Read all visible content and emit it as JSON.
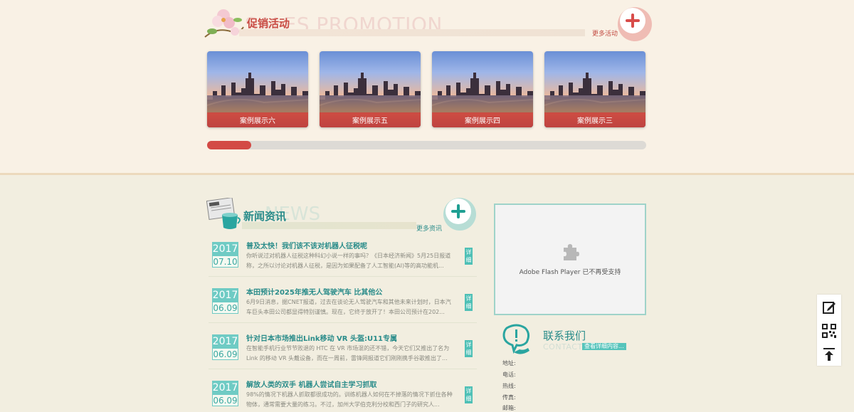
{
  "promotion": {
    "title": "促销活动",
    "bg_title": "SALES PROMOTION",
    "more_label": "更多活动",
    "cards": [
      {
        "caption": "案例展示六"
      },
      {
        "caption": "案例展示五"
      },
      {
        "caption": "案例展示四"
      },
      {
        "caption": "案例展示三"
      }
    ],
    "scroll_progress": 0.1
  },
  "news": {
    "title": "新闻资讯",
    "bg_title": "NEWS",
    "more_label": "更多资讯",
    "detail_label": "详细",
    "items": [
      {
        "year": "2017",
        "date": "07.10",
        "headline": "普及太快！我们该不该对机器人征税呢",
        "summary": "你听说过对机器人征税这种科幻小说一样的事吗？《日本经济新闻》5月25日报道称，之所以讨论对机器人征税，是因为如果配备了人工智能(AI)等的高功能机..."
      },
      {
        "year": "2017",
        "date": "06.09",
        "headline": "本田预计2025年推无人驾驶汽车 比其他公",
        "summary": "6月9日消息，据CNET报道，过去在谈论无人驾驶汽车和其他未来计划时，日本汽车巨头本田公司都显得特别谨慎。现在，它终于放开了！本田公司预计在202..."
      },
      {
        "year": "2017",
        "date": "06.09",
        "headline": "针对日本市场推出Link移动 VR 头盔:U11专属",
        "summary": "在智能手机行业节节败退的 HTC 在 VR 市场混的还不错，今天它们又推出了名为 Link 的移动 VR 头戴设备，而在一周前，雷锋网报道它们刚刚携手谷歌推出了..."
      },
      {
        "year": "2017",
        "date": "06.09",
        "headline": "解放人类的双手 机器人尝试自主学习抓取",
        "summary": "98%的情况下机器人抓取都很成功的。训练机器人如何在不掉落的情况下抓住各种物体，通常需要大量的练习。不过，加州大学伯克利分校和西门子的研究人..."
      }
    ]
  },
  "flash": {
    "message": "Adobe Flash Player 已不再受支持"
  },
  "contact": {
    "title": "联系我们",
    "bg_title": "CONTACT",
    "link_label": "查看详细内容...",
    "fields": [
      {
        "label": "地址:"
      },
      {
        "label": "电话:"
      },
      {
        "label": "热线:"
      },
      {
        "label": "传真:"
      },
      {
        "label": "邮箱:"
      }
    ]
  },
  "side_bar": {
    "icons": [
      "edit-icon",
      "qr-code-icon",
      "back-to-top-icon"
    ]
  },
  "colors": {
    "promo_accent": "#d34a45",
    "news_accent": "#2a8c8a",
    "teal_badge": "#6fcbc4",
    "promo_bg": "#f9f1e5",
    "news_bg": "#f2eee0"
  }
}
